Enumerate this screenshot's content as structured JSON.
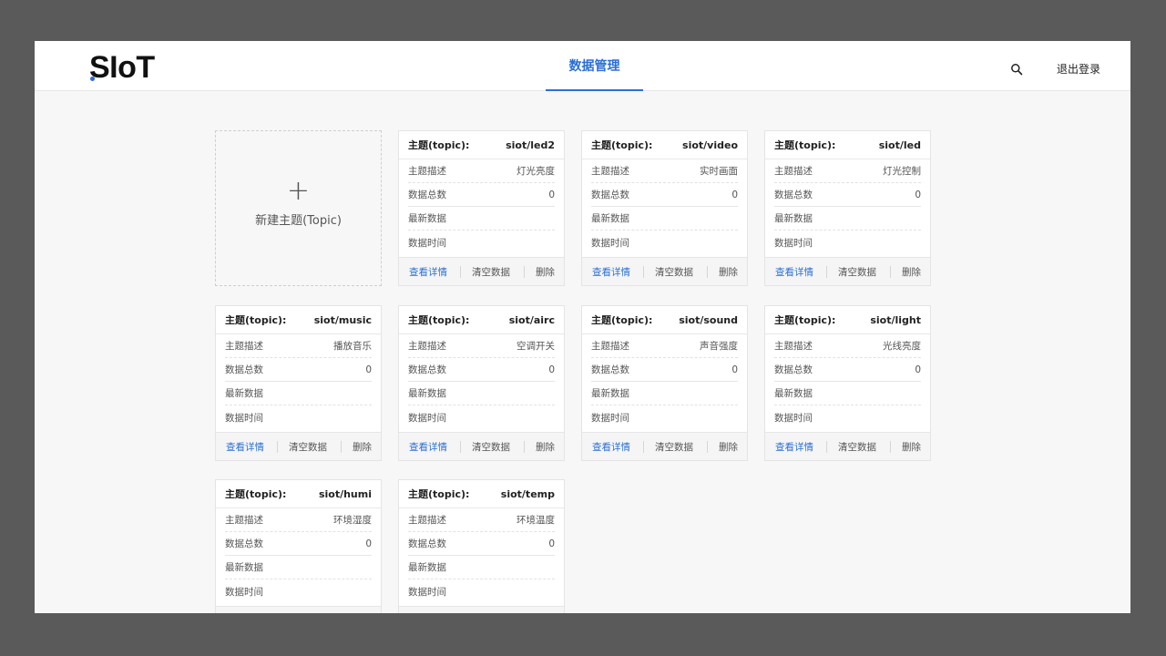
{
  "app": {
    "logo": "SIoT",
    "logo_accent_color": "#2b6fd6"
  },
  "header": {
    "nav_tab": "数据管理",
    "search_icon": "search-icon",
    "logout": "退出登录"
  },
  "new_topic": {
    "plus": "+",
    "label": "新建主题(Topic)"
  },
  "labels": {
    "topic": "主题(topic):",
    "desc": "主题描述",
    "count": "数据总数",
    "latest": "最新数据",
    "time": "数据时间",
    "view": "查看详情",
    "clear": "清空数据",
    "delete": "删除"
  },
  "cards": [
    {
      "name": "siot/led2",
      "desc": "灯光亮度",
      "count": "0",
      "latest": "",
      "time": ""
    },
    {
      "name": "siot/video",
      "desc": "实时画面",
      "count": "0",
      "latest": "",
      "time": ""
    },
    {
      "name": "siot/led",
      "desc": "灯光控制",
      "count": "0",
      "latest": "",
      "time": ""
    },
    {
      "name": "siot/music",
      "desc": "播放音乐",
      "count": "0",
      "latest": "",
      "time": ""
    },
    {
      "name": "siot/airc",
      "desc": "空调开关",
      "count": "0",
      "latest": "",
      "time": ""
    },
    {
      "name": "siot/sound",
      "desc": "声音强度",
      "count": "0",
      "latest": "",
      "time": ""
    },
    {
      "name": "siot/light",
      "desc": "光线亮度",
      "count": "0",
      "latest": "",
      "time": ""
    },
    {
      "name": "siot/humi",
      "desc": "环境湿度",
      "count": "0",
      "latest": "",
      "time": ""
    },
    {
      "name": "siot/temp",
      "desc": "环境温度",
      "count": "0",
      "latest": "",
      "time": ""
    }
  ]
}
